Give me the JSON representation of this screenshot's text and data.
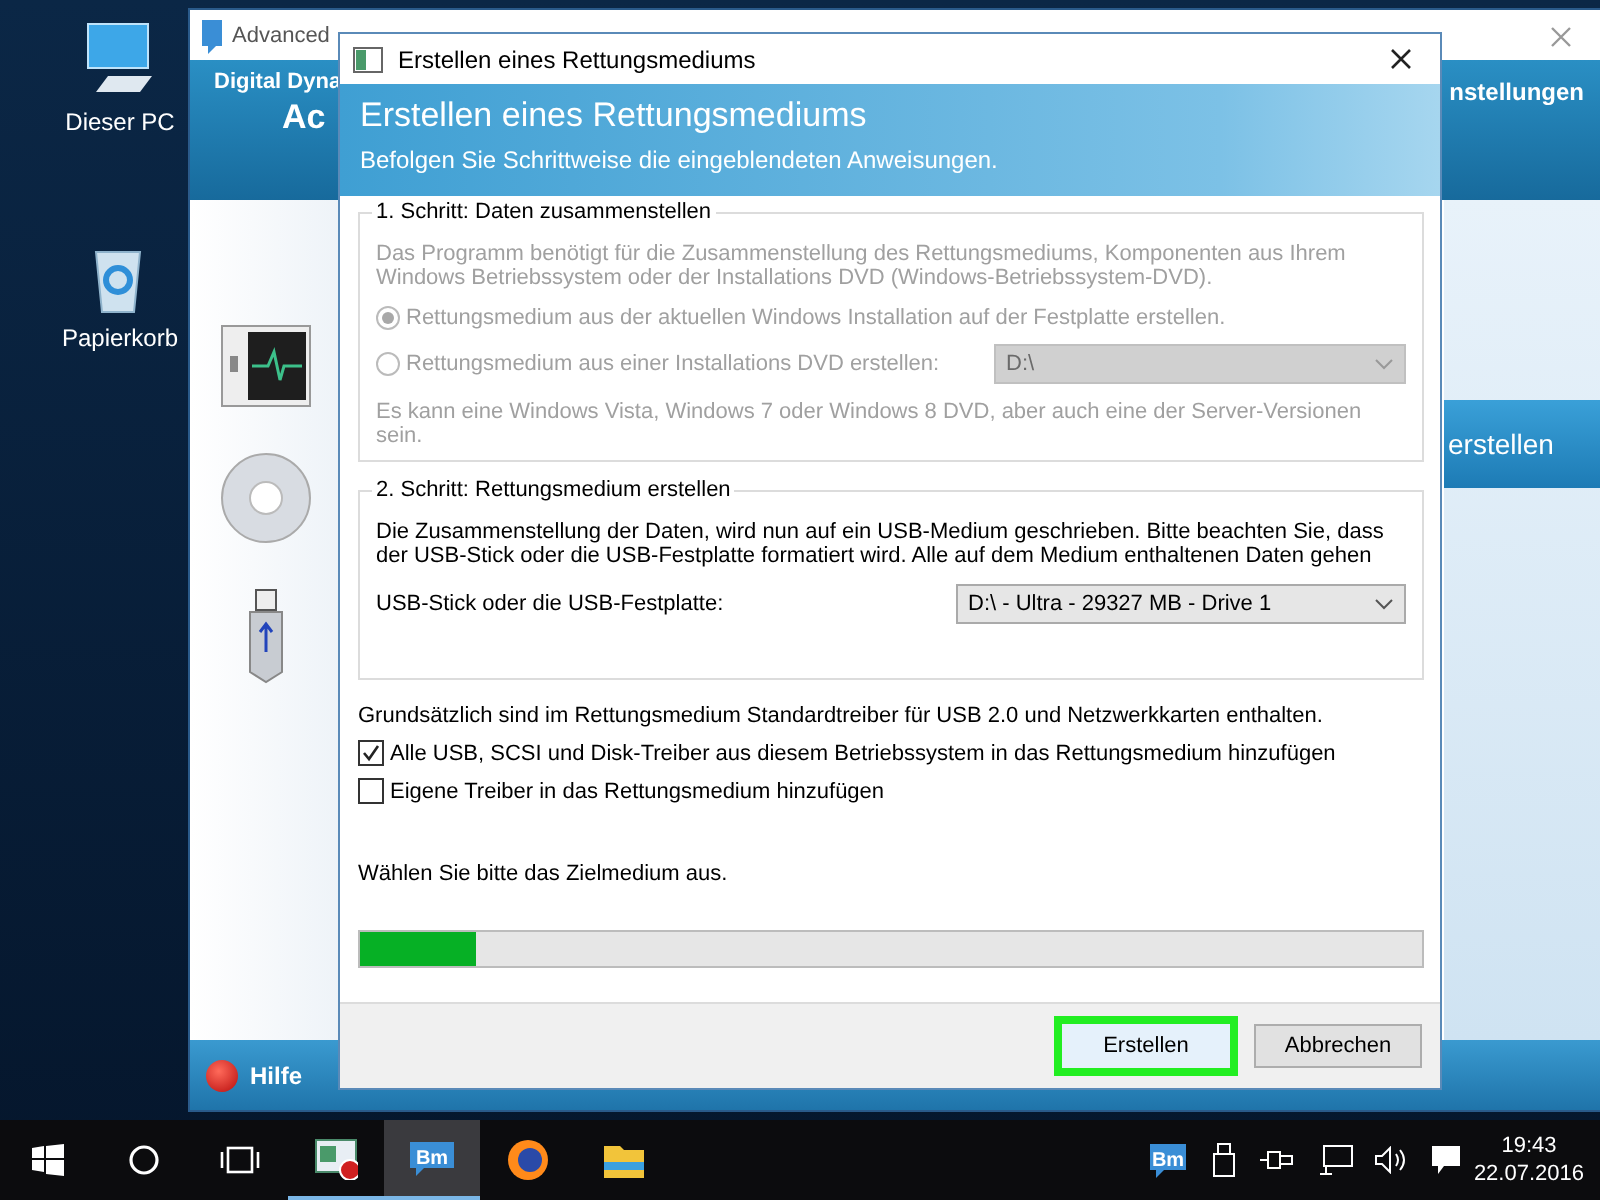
{
  "desktop_icons": [
    {
      "kind": "pc",
      "label": "Dieser PC"
    },
    {
      "kind": "bin",
      "label": "Papierkorb"
    }
  ],
  "background_window": {
    "title": "Advanced",
    "header_left": "Digital Dyna",
    "header_big": "Ac",
    "header_right": "nstellungen",
    "side_button": "erstellen",
    "help": "Hilfe"
  },
  "dialog": {
    "title": "Erstellen eines Rettungsmediums",
    "heading": "Erstellen eines Rettungsmediums",
    "subheading": "Befolgen Sie Schrittweise die eingeblendeten Anweisungen.",
    "step1": {
      "legend": "1. Schritt: Daten zusammenstellen",
      "disabled": true,
      "description": "Das Programm benötigt für die Zusammenstellung des Rettungsmediums, Komponenten aus Ihrem Windows Betriebssystem oder der Installations DVD (Windows-Betriebssystem-DVD).",
      "options": [
        {
          "label": "Rettungsmedium aus der aktuellen Windows Installation auf der Festplatte erstellen.",
          "selected": true
        },
        {
          "label": "Rettungsmedium aus einer Installations DVD erstellen:",
          "selected": false,
          "dropdown": "D:\\"
        }
      ],
      "note": "Es kann eine Windows Vista, Windows 7 oder Windows 8 DVD, aber auch eine der Server-Versionen sein."
    },
    "step2": {
      "legend": "2. Schritt: Rettungsmedium erstellen",
      "description": "Die Zusammenstellung der Daten, wird nun auf ein USB-Medium geschrieben. Bitte beachten Sie, dass der USB-Stick oder die USB-Festplatte formatiert wird. Alle auf dem Medium enthaltenen Daten gehen",
      "drive_label": "USB-Stick oder die USB-Festplatte:",
      "drive_value": "D:\\ - Ultra - 29327 MB - Drive 1"
    },
    "info": "Grundsätzlich sind im Rettungsmedium Standardtreiber für USB 2.0 und Netzwerkkarten enthalten.",
    "checkboxes": [
      {
        "label": "Alle USB, SCSI und Disk-Treiber aus diesem Betriebssystem in das Rettungsmedium hinzufügen",
        "checked": true
      },
      {
        "label": "Eigene Treiber in das Rettungsmedium hinzufügen",
        "checked": false
      }
    ],
    "status": "Wählen Sie bitte das Zielmedium aus.",
    "progress": {
      "level": 0.11
    },
    "buttons": [
      {
        "label": "Erstellen",
        "highlighted": true
      },
      {
        "label": "Abbrechen",
        "highlighted": false
      }
    ]
  },
  "taskbar": {
    "apps": [
      {
        "kind": "tool",
        "selected": false,
        "running": true
      },
      {
        "kind": "bm",
        "label": "Bm",
        "selected": true,
        "running": true
      },
      {
        "kind": "browser",
        "selected": false,
        "running": false
      },
      {
        "kind": "folder",
        "selected": false,
        "running": false
      }
    ],
    "tray": [
      {
        "kind": "bm",
        "label": "Bm"
      },
      {
        "kind": "usb"
      },
      {
        "kind": "plug"
      },
      {
        "kind": "network"
      },
      {
        "kind": "speaker"
      },
      {
        "kind": "notes"
      }
    ],
    "time": "19:43",
    "date": "22.07.2016"
  }
}
